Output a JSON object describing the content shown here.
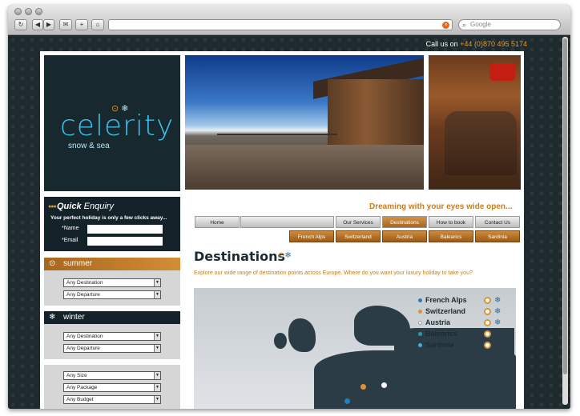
{
  "browser": {
    "buttons": [
      "↻",
      "◀",
      "▶",
      "✉",
      "+",
      "⌂"
    ],
    "search_placeholder": "Google",
    "stop_icon": "stop-icon"
  },
  "header": {
    "call_label": "Call us on",
    "phone": "+44 (0)870 495 5174"
  },
  "brand": {
    "name": "celerity",
    "tagline": "snow & sea"
  },
  "enquiry": {
    "title_bold": "Quick",
    "title_rest": "Enquiry",
    "tagline": "Your perfect holiday is only a few clicks away...",
    "name_label": "*Name",
    "email_label": "*Email"
  },
  "summer": {
    "label": "summer",
    "selects": [
      "Any Destination",
      "Any Departure"
    ]
  },
  "winter": {
    "label": "winter",
    "selects": [
      "Any Destination",
      "Any Departure"
    ]
  },
  "extra": {
    "selects": [
      "Any Size",
      "Any Package",
      "Any Budget"
    ]
  },
  "slogan": "Dreaming with your eyes wide open...",
  "nav": {
    "tabs": [
      "Home",
      "",
      "Our Services",
      "Destinations",
      "How to book",
      "Contact Us"
    ],
    "active_index": 3
  },
  "destinations_nav": [
    "French Alps",
    "Switzerland",
    "Austria",
    "Balearics",
    "Sardinia"
  ],
  "main": {
    "title": "Destinations",
    "intro": "Explore our wide range of destination points across Europe. Where do you want your luxury holiday to take you?"
  },
  "legend": [
    {
      "name": "French Alps",
      "dot": "#2b7bb5",
      "summer": true,
      "winter": true
    },
    {
      "name": "Switzerland",
      "dot": "#d9943a",
      "summer": true,
      "winter": true
    },
    {
      "name": "Austria",
      "dot": "#ffffff",
      "summer": true,
      "winter": true
    },
    {
      "name": "Balearics",
      "dot": "#2b9aa6",
      "summer": true,
      "winter": false
    },
    {
      "name": "Sardinia",
      "dot": "#4aaad8",
      "summer": true,
      "winter": false
    }
  ],
  "colors": {
    "accent": "#d9943a",
    "dark": "#142329",
    "brand_blue": "#3ec0ec"
  }
}
